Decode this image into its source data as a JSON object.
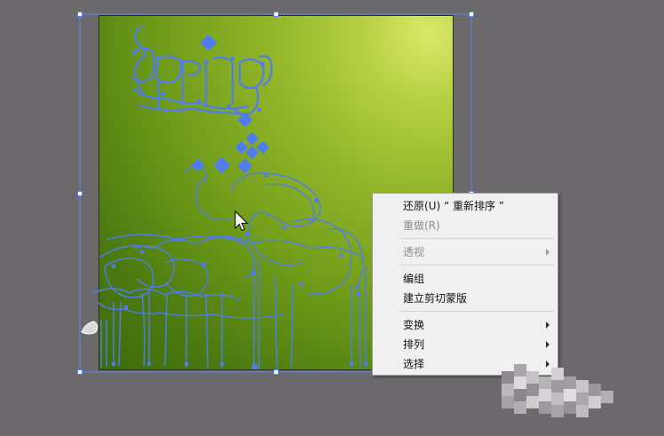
{
  "canvas": {
    "background_color": "#6b696b",
    "artboard_colors": [
      "#d9e868",
      "#92b529",
      "#3e6a0c"
    ],
    "path_color": "#4f7df0"
  },
  "artwork": {
    "text_outline": "Spring"
  },
  "context_menu": {
    "items": [
      {
        "label": "还原(U) “ 重新排序 ”",
        "enabled": true,
        "submenu": false
      },
      {
        "label": "重做(R)",
        "enabled": false,
        "submenu": false
      },
      {
        "separator": true
      },
      {
        "label": "透视",
        "enabled": false,
        "submenu": true
      },
      {
        "separator": true
      },
      {
        "label": "编组",
        "enabled": true,
        "submenu": false
      },
      {
        "label": "建立剪切蒙版",
        "enabled": true,
        "submenu": false
      },
      {
        "separator": true
      },
      {
        "label": "变换",
        "enabled": true,
        "submenu": true
      },
      {
        "label": "排列",
        "enabled": true,
        "submenu": true
      },
      {
        "label": "选择",
        "enabled": true,
        "submenu": true
      }
    ]
  }
}
